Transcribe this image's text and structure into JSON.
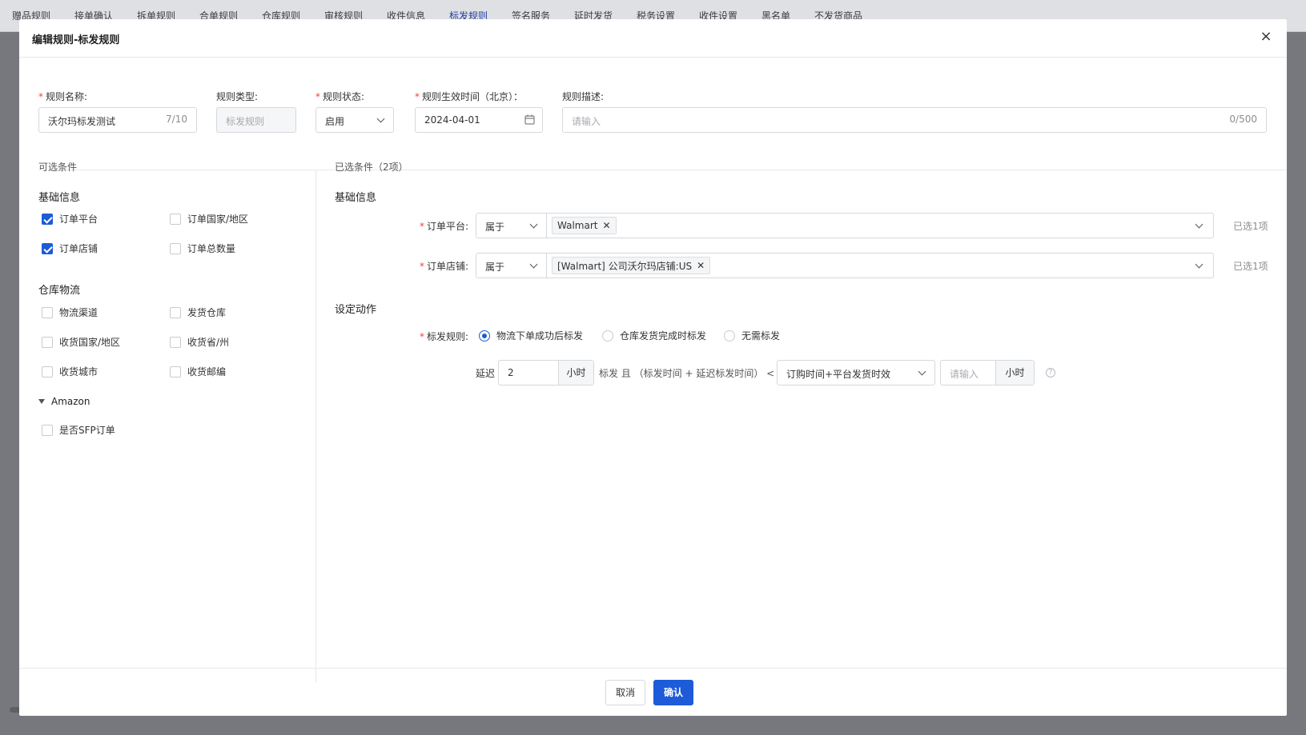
{
  "background": {
    "tabs": [
      "赠品规则",
      "接单确认",
      "拆单规则",
      "合单规则",
      "仓库规则",
      "审核规则",
      "收件信息",
      "标发规则",
      "签名服务",
      "延时发货",
      "税务设置",
      "收件设置",
      "黑名单",
      "不发货商品"
    ],
    "active_tab": "标发规则"
  },
  "modal": {
    "title": "编辑规则-标发规则",
    "close": "×"
  },
  "form": {
    "name": {
      "label": "规则名称:",
      "value": "沃尔玛标发测试",
      "count": "7/10"
    },
    "type": {
      "label": "规则类型:",
      "value": "标发规则"
    },
    "status": {
      "label": "规则状态:",
      "value": "启用"
    },
    "effective": {
      "label": "规则生效时间（北京）：",
      "value": "2024-04-01"
    },
    "desc": {
      "label": "规则描述:",
      "placeholder": "请输入",
      "count": "0/500"
    }
  },
  "available": {
    "title": "可选条件",
    "groups": [
      {
        "title": "基础信息",
        "items": [
          {
            "label": "订单平台",
            "checked": true
          },
          {
            "label": "订单国家/地区",
            "checked": false
          },
          {
            "label": "订单店铺",
            "checked": true
          },
          {
            "label": "订单总数量",
            "checked": false
          }
        ]
      },
      {
        "title": "仓库物流",
        "items": [
          {
            "label": "物流渠道",
            "checked": false
          },
          {
            "label": "发货仓库",
            "checked": false
          },
          {
            "label": "收货国家/地区",
            "checked": false
          },
          {
            "label": "收货省/州",
            "checked": false
          },
          {
            "label": "收货城市",
            "checked": false
          },
          {
            "label": "收货邮编",
            "checked": false
          }
        ]
      },
      {
        "title": "Amazon",
        "items": [
          {
            "label": "是否SFP订单",
            "checked": false
          }
        ]
      }
    ]
  },
  "selected": {
    "title": "已选条件（2项）",
    "group_title": "基础信息",
    "conditions": [
      {
        "label": "订单平台:",
        "operator": "属于",
        "tag": "Walmart",
        "count": "已选1项"
      },
      {
        "label": "订单店铺:",
        "operator": "属于",
        "tag": "[Walmart] 公司沃尔玛店铺:US",
        "count": "已选1项"
      }
    ],
    "action_title": "设定动作",
    "action": {
      "label": "标发规则:",
      "options": [
        "物流下单成功后标发",
        "仓库发货完成时标发",
        "无需标发"
      ],
      "selected": "物流下单成功后标发"
    },
    "delay": {
      "prefix": "延迟",
      "value": "2",
      "unit": "小时",
      "middle": "标发 且 （标发时间 + 延迟标发时间） <",
      "compare_select": "订购时间+平台发货时效",
      "hours_placeholder": "请输入",
      "hours_unit": "小时",
      "help": "?"
    }
  },
  "footer": {
    "cancel": "取消",
    "confirm": "确认"
  },
  "colors": {
    "primary": "#1d5bd8",
    "required": "#f0463c",
    "overlay": "#76787d"
  }
}
